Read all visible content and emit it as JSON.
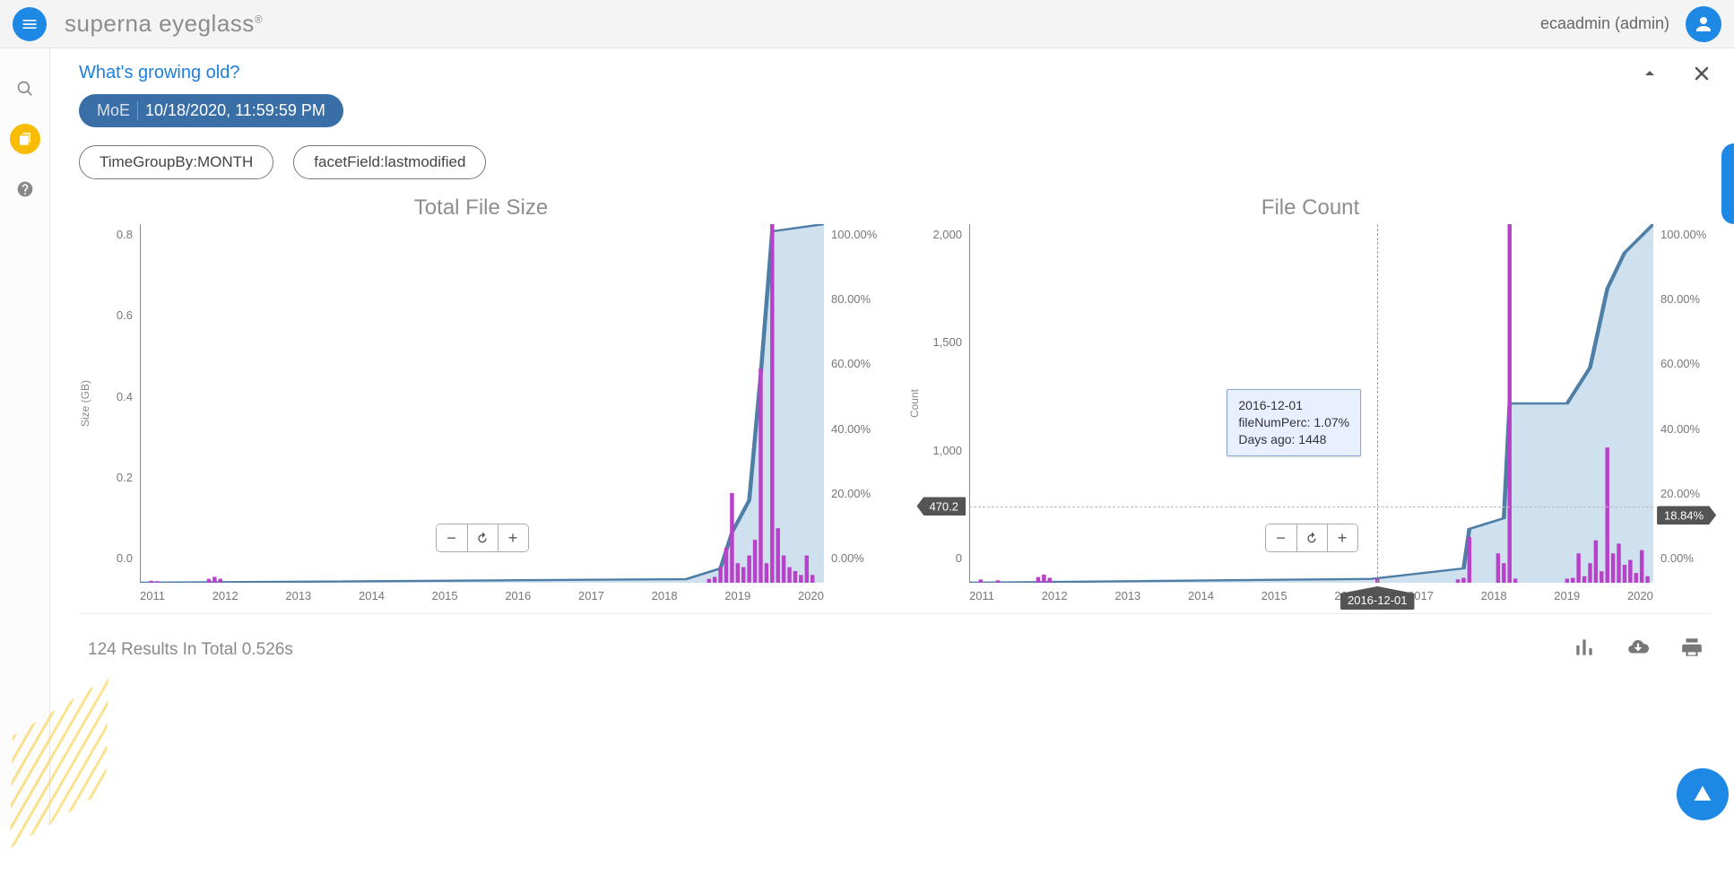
{
  "brand_html": "superna eyeglass",
  "user_label": "ecaadmin (admin)",
  "page_title": "What's growing old?",
  "date_chip": {
    "prefix": "MoE",
    "value": "10/18/2020, 11:59:59 PM"
  },
  "filters": {
    "timeGroupBy": "TimeGroupBy:MONTH",
    "facetField": "facetField:lastmodified"
  },
  "results_summary": "124 Results In Total 0.526s",
  "chart_data": [
    {
      "id": "size",
      "type": "bar+area",
      "title": "Total File Size",
      "ylabel": "Size (GB)",
      "y_left_ticks": [
        "0.8",
        "0.6",
        "0.4",
        "0.2",
        "0.0"
      ],
      "y_right_ticks": [
        "100.00%",
        "80.00%",
        "60.00%",
        "40.00%",
        "20.00%",
        "0.00%"
      ],
      "x_ticks": [
        "2011",
        "2012",
        "2013",
        "2014",
        "2015",
        "2016",
        "2017",
        "2018",
        "2019",
        "2020"
      ],
      "ylim_left": [
        0.0,
        0.92
      ],
      "ylim_right_pct": [
        0,
        100
      ],
      "bars_comment": "index is month offset from Jan-2011 (0..119); value is Size in GB (approx from chart)",
      "bars": {
        "2": 0.005,
        "3": 0.004,
        "12": 0.01,
        "13": 0.015,
        "14": 0.01,
        "99": 0.01,
        "100": 0.015,
        "101": 0.04,
        "102": 0.09,
        "103": 0.23,
        "104": 0.05,
        "105": 0.04,
        "106": 0.07,
        "107": 0.11,
        "108": 0.55,
        "109": 0.05,
        "110": 0.95,
        "111": 0.14,
        "112": 0.07,
        "113": 0.04,
        "114": 0.03,
        "115": 0.02,
        "116": 0.07,
        "117": 0.02
      },
      "cumulative_pct_points": [
        {
          "i": 0,
          "p": 0
        },
        {
          "i": 95,
          "p": 1
        },
        {
          "i": 101,
          "p": 4
        },
        {
          "i": 103,
          "p": 14
        },
        {
          "i": 106,
          "p": 23
        },
        {
          "i": 108,
          "p": 58
        },
        {
          "i": 110,
          "p": 98
        },
        {
          "i": 119,
          "p": 100
        }
      ]
    },
    {
      "id": "count",
      "type": "bar+area",
      "title": "File Count",
      "ylabel": "Count",
      "y_left_ticks": [
        "2,000",
        "1,500",
        "1,000",
        "0"
      ],
      "y_left_tick_values": [
        2000,
        1500,
        1000,
        0
      ],
      "y_right_ticks": [
        "100.00%",
        "80.00%",
        "60.00%",
        "40.00%",
        "20.00%",
        "0.00%"
      ],
      "x_ticks": [
        "2011",
        "2012",
        "2013",
        "2014",
        "2015",
        "2016",
        "2017",
        "2018",
        "2019",
        "2020"
      ],
      "ylim_left": [
        0,
        2200
      ],
      "ylim_right_pct": [
        0,
        100
      ],
      "bars": {
        "2": 20,
        "5": 15,
        "12": 35,
        "13": 50,
        "14": 30,
        "71": 25,
        "85": 20,
        "86": 30,
        "87": 280,
        "92": 180,
        "93": 120,
        "94": 2200,
        "95": 25,
        "104": 25,
        "105": 30,
        "106": 180,
        "107": 40,
        "108": 120,
        "109": 260,
        "110": 70,
        "111": 830,
        "112": 180,
        "113": 240,
        "114": 110,
        "115": 140,
        "116": 60,
        "117": 200,
        "118": 40
      },
      "cumulative_pct_points": [
        {
          "i": 0,
          "p": 0
        },
        {
          "i": 70,
          "p": 1.07
        },
        {
          "i": 86,
          "p": 4
        },
        {
          "i": 87,
          "p": 15
        },
        {
          "i": 93,
          "p": 18
        },
        {
          "i": 94,
          "p": 50
        },
        {
          "i": 104,
          "p": 50
        },
        {
          "i": 108,
          "p": 60
        },
        {
          "i": 111,
          "p": 82
        },
        {
          "i": 114,
          "p": 92
        },
        {
          "i": 119,
          "p": 100
        }
      ],
      "hover": {
        "index": 71,
        "left_value": 470.2,
        "right_pct": 18.84,
        "date_label": "2016-12-01",
        "tooltip_lines": [
          "2016-12-01",
          "fileNumPerc: 1.07%",
          "Days ago: 1448"
        ]
      }
    }
  ],
  "colors": {
    "bar": "#b741c9",
    "area_fill": "#cfe1ef",
    "area_line": "#4f7fa6",
    "accent": "#1e88e5"
  }
}
